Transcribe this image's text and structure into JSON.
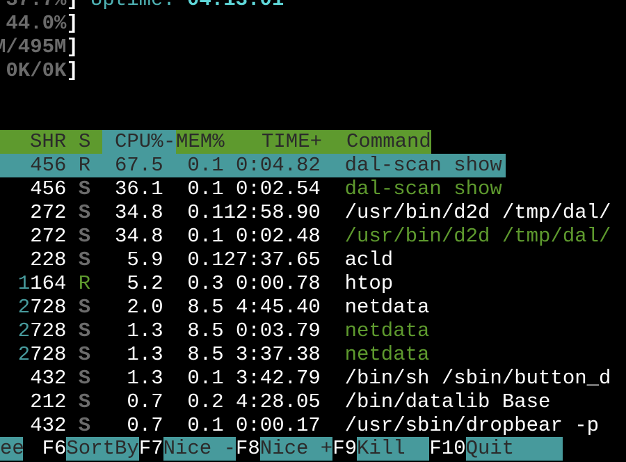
{
  "meters": [
    {
      "value": "37.7%",
      "bracket": "]"
    },
    {
      "value": "44.0%",
      "bracket": "]"
    },
    {
      "value": "M/495M",
      "bracket": "]"
    },
    {
      "value": "0K/0K",
      "bracket": "]"
    }
  ],
  "uptime": {
    "label": "Uptime:",
    "value": "04:13:01"
  },
  "header": {
    "shr": "SHR",
    "s": "S",
    "cpu": "CPU%",
    "sort_arrow": "-",
    "mem": "MEM%",
    "time": "TIME+",
    "command": "Command"
  },
  "colors": {
    "green": "#5e9a2e",
    "cyan": "#479a9c",
    "background": "#000000"
  },
  "processes": [
    {
      "shr_hi": "",
      "shr": "456",
      "s": "R",
      "cpu": "67.5",
      "mem": "0.1",
      "time": "0:04.82",
      "command": "dal-scan show",
      "thread": false,
      "selected": true
    },
    {
      "shr_hi": "",
      "shr": "456",
      "s": "S",
      "cpu": "36.1",
      "mem": "0.1",
      "time": "0:02.54",
      "command": "dal-scan show",
      "thread": true,
      "selected": false
    },
    {
      "shr_hi": "",
      "shr": "272",
      "s": "S",
      "cpu": "34.8",
      "mem": "0.1",
      "time": "12:58.90",
      "command": "/usr/bin/d2d /tmp/dal/",
      "thread": false,
      "selected": false
    },
    {
      "shr_hi": "",
      "shr": "272",
      "s": "S",
      "cpu": "34.8",
      "mem": "0.1",
      "time": "0:02.48",
      "command": "/usr/bin/d2d /tmp/dal/",
      "thread": true,
      "selected": false
    },
    {
      "shr_hi": "",
      "shr": "228",
      "s": "S",
      "cpu": "5.9",
      "mem": "0.1",
      "time": "27:37.65",
      "command": "acld",
      "thread": false,
      "selected": false
    },
    {
      "shr_hi": "1",
      "shr": "164",
      "s": "R",
      "cpu": "5.2",
      "mem": "0.3",
      "time": "0:00.78",
      "command": "htop",
      "thread": false,
      "selected": false
    },
    {
      "shr_hi": "2",
      "shr": "728",
      "s": "S",
      "cpu": "2.0",
      "mem": "8.5",
      "time": "4:45.40",
      "command": "netdata",
      "thread": false,
      "selected": false
    },
    {
      "shr_hi": "2",
      "shr": "728",
      "s": "S",
      "cpu": "1.3",
      "mem": "8.5",
      "time": "0:03.79",
      "command": "netdata",
      "thread": true,
      "selected": false
    },
    {
      "shr_hi": "2",
      "shr": "728",
      "s": "S",
      "cpu": "1.3",
      "mem": "8.5",
      "time": "3:37.38",
      "command": "netdata",
      "thread": true,
      "selected": false
    },
    {
      "shr_hi": "",
      "shr": "432",
      "s": "S",
      "cpu": "1.3",
      "mem": "0.1",
      "time": "3:42.79",
      "command": "/bin/sh /sbin/button_d",
      "thread": false,
      "selected": false
    },
    {
      "shr_hi": "",
      "shr": "212",
      "s": "S",
      "cpu": "0.7",
      "mem": "0.2",
      "time": "4:28.05",
      "command": "/bin/datalib Base",
      "thread": false,
      "selected": false
    },
    {
      "shr_hi": "",
      "shr": "432",
      "s": "S",
      "cpu": "0.7",
      "mem": "0.1",
      "time": "0:00.17",
      "command": "/usr/sbin/dropbear -p",
      "thread": false,
      "selected": false
    }
  ],
  "function_bar": [
    {
      "key": "",
      "label": "ee"
    },
    {
      "key": "F6",
      "label": "SortBy"
    },
    {
      "key": "F7",
      "label": "Nice -"
    },
    {
      "key": "F8",
      "label": "Nice +"
    },
    {
      "key": "F9",
      "label": "Kill  "
    },
    {
      "key": "F10",
      "label": "Quit    "
    }
  ]
}
